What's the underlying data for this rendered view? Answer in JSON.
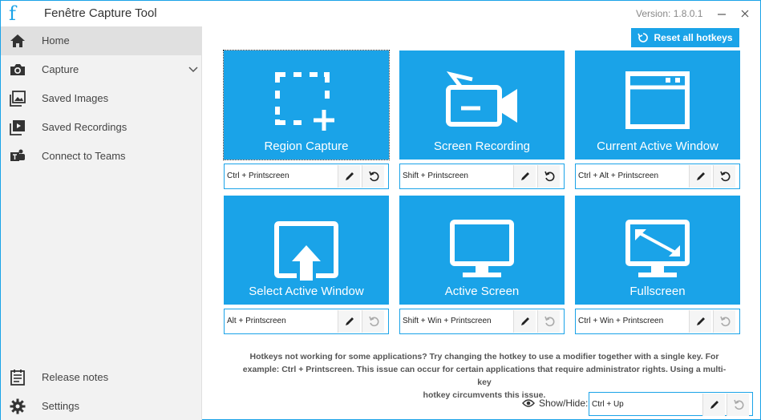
{
  "app": {
    "logo": "f",
    "title": "Fenêtre Capture Tool",
    "version": "Version: 1.8.0.1"
  },
  "sidebar": {
    "items": [
      {
        "label": "Home",
        "icon": "home-icon"
      },
      {
        "label": "Capture",
        "icon": "camera-icon"
      },
      {
        "label": "Saved Images",
        "icon": "images-icon"
      },
      {
        "label": "Saved Recordings",
        "icon": "recordings-icon"
      },
      {
        "label": "Connect to Teams",
        "icon": "teams-icon"
      },
      {
        "label": "Release notes",
        "icon": "notes-icon"
      },
      {
        "label": "Settings",
        "icon": "gear-icon"
      }
    ]
  },
  "toolbar": {
    "reset_label": "Reset all hotkeys"
  },
  "tiles": [
    {
      "label": "Region Capture",
      "hotkey": "Ctrl + Printscreen"
    },
    {
      "label": "Screen Recording",
      "hotkey": "Shift + Printscreen"
    },
    {
      "label": "Current Active Window",
      "hotkey": "Ctrl + Alt + Printscreen"
    },
    {
      "label": "Select Active Window",
      "hotkey": "Alt + Printscreen"
    },
    {
      "label": "Active Screen",
      "hotkey": "Shift + Win + Printscreen"
    },
    {
      "label": "Fullscreen",
      "hotkey": "Ctrl + Win + Printscreen"
    }
  ],
  "notice": {
    "line1": "Hotkeys not working for some applications? Try changing the hotkey to use a modifier together with a single key. For",
    "line2": "example: Ctrl + Printscreen. This issue can occur for certain applications that require administrator rights. Using a multi-key",
    "line3": "hotkey circumvents this issue."
  },
  "showhide": {
    "label": "Show/Hide:",
    "hotkey": "Ctrl + Up"
  },
  "colors": {
    "accent": "#1aa3e8",
    "sidebar_bg": "#f2f2f2",
    "active_item_bg": "#e0e0e0"
  }
}
